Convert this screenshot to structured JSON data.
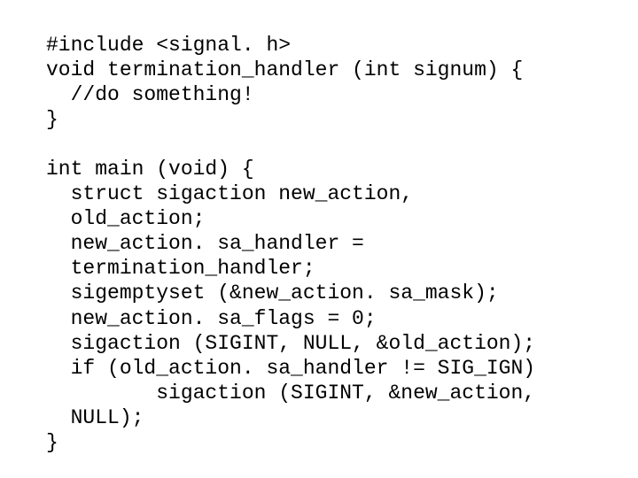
{
  "code": {
    "lines": [
      "#include <signal. h>",
      "void termination_handler (int signum) {",
      "  //do something!",
      "}",
      "",
      "int main (void) {",
      "  struct sigaction new_action,",
      "  old_action;",
      "  new_action. sa_handler =",
      "  termination_handler;",
      "  sigemptyset (&new_action. sa_mask);",
      "  new_action. sa_flags = 0;",
      "  sigaction (SIGINT, NULL, &old_action);",
      "  if (old_action. sa_handler != SIG_IGN)",
      "         sigaction (SIGINT, &new_action,",
      "  NULL);",
      "}"
    ]
  }
}
